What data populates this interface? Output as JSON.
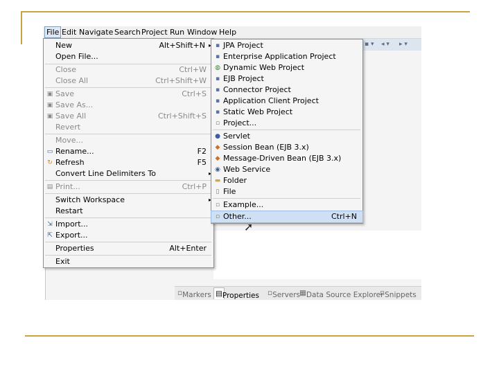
{
  "menubar": {
    "items": [
      "File",
      "Edit",
      "Navigate",
      "Search",
      "Project",
      "Run",
      "Window",
      "Help"
    ]
  },
  "file_menu": {
    "items": [
      {
        "label": "New",
        "shortcut": "Alt+Shift+N",
        "has_submenu": true,
        "disabled": false,
        "icon": ""
      },
      {
        "label": "Open File...",
        "shortcut": "",
        "disabled": false,
        "icon": ""
      },
      {
        "label": "Close",
        "shortcut": "Ctrl+W",
        "disabled": true,
        "icon": ""
      },
      {
        "label": "Close All",
        "shortcut": "Ctrl+Shift+W",
        "disabled": true,
        "icon": ""
      },
      {
        "label": "Save",
        "shortcut": "Ctrl+S",
        "disabled": true,
        "icon": "save-icon"
      },
      {
        "label": "Save As...",
        "shortcut": "",
        "disabled": true,
        "icon": "save-as-icon"
      },
      {
        "label": "Save All",
        "shortcut": "Ctrl+Shift+S",
        "disabled": true,
        "icon": "save-all-icon"
      },
      {
        "label": "Revert",
        "shortcut": "",
        "disabled": true,
        "icon": ""
      },
      {
        "label": "Move...",
        "shortcut": "",
        "disabled": true,
        "icon": ""
      },
      {
        "label": "Rename...",
        "shortcut": "F2",
        "disabled": false,
        "icon": "rename-icon"
      },
      {
        "label": "Refresh",
        "shortcut": "F5",
        "disabled": false,
        "icon": "refresh-icon"
      },
      {
        "label": "Convert Line Delimiters To",
        "shortcut": "",
        "has_submenu": true,
        "disabled": false,
        "icon": ""
      },
      {
        "label": "Print...",
        "shortcut": "Ctrl+P",
        "disabled": true,
        "icon": "print-icon"
      },
      {
        "label": "Switch Workspace",
        "shortcut": "",
        "has_submenu": true,
        "disabled": false,
        "icon": ""
      },
      {
        "label": "Restart",
        "shortcut": "",
        "disabled": false,
        "icon": ""
      },
      {
        "label": "Import...",
        "shortcut": "",
        "disabled": false,
        "icon": "import-icon"
      },
      {
        "label": "Export...",
        "shortcut": "",
        "disabled": false,
        "icon": "export-icon"
      },
      {
        "label": "Properties",
        "shortcut": "Alt+Enter",
        "disabled": false,
        "icon": ""
      },
      {
        "label": "Exit",
        "shortcut": "",
        "disabled": false,
        "icon": ""
      }
    ]
  },
  "new_submenu": {
    "items": [
      {
        "label": "JPA Project",
        "shortcut": "",
        "icon": "jpa-project-icon"
      },
      {
        "label": "Enterprise Application Project",
        "shortcut": "",
        "icon": "enterprise-project-icon"
      },
      {
        "label": "Dynamic Web Project",
        "shortcut": "",
        "icon": "dynamic-web-project-icon"
      },
      {
        "label": "EJB Project",
        "shortcut": "",
        "icon": "ejb-project-icon"
      },
      {
        "label": "Connector Project",
        "shortcut": "",
        "icon": "connector-project-icon"
      },
      {
        "label": "Application Client Project",
        "shortcut": "",
        "icon": "app-client-project-icon"
      },
      {
        "label": "Static Web Project",
        "shortcut": "",
        "icon": "static-web-project-icon"
      },
      {
        "label": "Project...",
        "shortcut": "",
        "icon": "project-icon"
      },
      {
        "label": "Servlet",
        "shortcut": "",
        "icon": "servlet-icon"
      },
      {
        "label": "Session Bean (EJB 3.x)",
        "shortcut": "",
        "icon": "session-bean-icon"
      },
      {
        "label": "Message-Driven Bean (EJB 3.x)",
        "shortcut": "",
        "icon": "message-driven-bean-icon"
      },
      {
        "label": "Web Service",
        "shortcut": "",
        "icon": "web-service-icon"
      },
      {
        "label": "Folder",
        "shortcut": "",
        "icon": "folder-icon"
      },
      {
        "label": "File",
        "shortcut": "",
        "icon": "file-icon"
      },
      {
        "label": "Example...",
        "shortcut": "",
        "icon": "example-icon"
      },
      {
        "label": "Other...",
        "shortcut": "Ctrl+N",
        "icon": "other-icon",
        "highlighted": true
      }
    ]
  },
  "bottom_tabs": {
    "items": [
      "Markers",
      "Properties",
      "Servers",
      "Data Source Explorer",
      "Snippets"
    ],
    "active": "Properties"
  },
  "colors": {
    "slide_rule": "#c9a33b",
    "highlight": "#cfe0f5"
  }
}
